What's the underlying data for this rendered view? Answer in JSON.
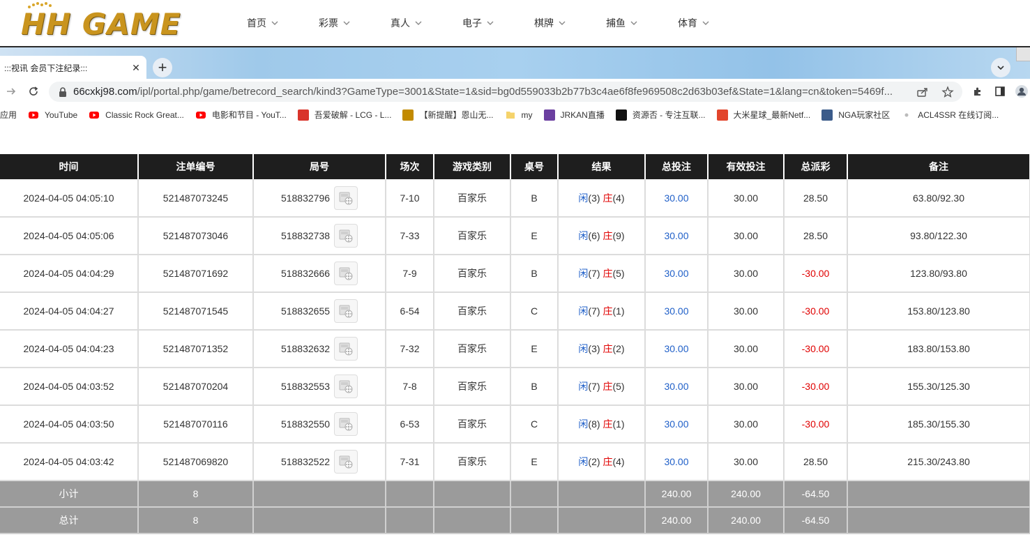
{
  "site": {
    "logo_text": "HH GAME",
    "nav": [
      "首页",
      "彩票",
      "真人",
      "电子",
      "棋牌",
      "捕鱼",
      "体育"
    ]
  },
  "browser": {
    "tab_title": ":::视讯 会员下注纪录:::",
    "url_host": "66cxkj98.com",
    "url_path": "/ipl/portal.php/game/betrecord_search/kind3?GameType=3001&State=1&sid=bg0d559033b2b77b3c4ae6f8fe969508c2d63b03ef&State=1&lang=cn&token=5469f...",
    "bookmarks": [
      {
        "label": "应用",
        "icon": "apps-icon",
        "color": ""
      },
      {
        "label": "YouTube",
        "icon": "youtube-icon",
        "color": "#ff0000"
      },
      {
        "label": "Classic Rock Great...",
        "icon": "youtube-icon",
        "color": "#ff0000"
      },
      {
        "label": "电影和节目 - YouT...",
        "icon": "youtube-icon",
        "color": "#ff0000"
      },
      {
        "label": "吾爱破解 - LCG - L...",
        "icon": "lcg-icon",
        "color": "#d9342b"
      },
      {
        "label": "【新提醒】恩山无...",
        "icon": "right-icon",
        "color": "#c28a00"
      },
      {
        "label": "my",
        "icon": "folder-icon",
        "color": "#f5d36b"
      },
      {
        "label": "JRKAN直播",
        "icon": "jrkan-icon",
        "color": "#6b3fa0"
      },
      {
        "label": "资源否 - 专注互联...",
        "icon": "github-icon",
        "color": "#111111"
      },
      {
        "label": "大米星球_最新Netf...",
        "icon": "rice-icon",
        "color": "#e2452c"
      },
      {
        "label": "NGA玩家社区",
        "icon": "nga-icon",
        "color": "#3b5b8a"
      },
      {
        "label": "ACL4SSR 在线订阅...",
        "icon": "acl-icon",
        "color": "#bbbbbb"
      }
    ]
  },
  "table": {
    "headers": [
      "时间",
      "注单编号",
      "局号",
      "场次",
      "游戏类别",
      "桌号",
      "结果",
      "总投注",
      "有效投注",
      "总派彩",
      "备注"
    ],
    "player_label": "闲",
    "banker_label": "庄",
    "rows": [
      {
        "time": "2024-04-05 04:05:10",
        "bet_id": "521487073245",
        "round": "518832796",
        "session": "7-10",
        "game": "百家乐",
        "table": "B",
        "player": "(3)",
        "banker": "(4)",
        "total": "30.00",
        "valid": "30.00",
        "payout": "28.50",
        "note": "63.80/92.30"
      },
      {
        "time": "2024-04-05 04:05:06",
        "bet_id": "521487073046",
        "round": "518832738",
        "session": "7-33",
        "game": "百家乐",
        "table": "E",
        "player": "(6)",
        "banker": "(9)",
        "total": "30.00",
        "valid": "30.00",
        "payout": "28.50",
        "note": "93.80/122.30"
      },
      {
        "time": "2024-04-05 04:04:29",
        "bet_id": "521487071692",
        "round": "518832666",
        "session": "7-9",
        "game": "百家乐",
        "table": "B",
        "player": "(7)",
        "banker": "(5)",
        "total": "30.00",
        "valid": "30.00",
        "payout": "-30.00",
        "note": "123.80/93.80"
      },
      {
        "time": "2024-04-05 04:04:27",
        "bet_id": "521487071545",
        "round": "518832655",
        "session": "6-54",
        "game": "百家乐",
        "table": "C",
        "player": "(7)",
        "banker": "(1)",
        "total": "30.00",
        "valid": "30.00",
        "payout": "-30.00",
        "note": "153.80/123.80"
      },
      {
        "time": "2024-04-05 04:04:23",
        "bet_id": "521487071352",
        "round": "518832632",
        "session": "7-32",
        "game": "百家乐",
        "table": "E",
        "player": "(3)",
        "banker": "(2)",
        "total": "30.00",
        "valid": "30.00",
        "payout": "-30.00",
        "note": "183.80/153.80"
      },
      {
        "time": "2024-04-05 04:03:52",
        "bet_id": "521487070204",
        "round": "518832553",
        "session": "7-8",
        "game": "百家乐",
        "table": "B",
        "player": "(7)",
        "banker": "(5)",
        "total": "30.00",
        "valid": "30.00",
        "payout": "-30.00",
        "note": "155.30/125.30"
      },
      {
        "time": "2024-04-05 04:03:50",
        "bet_id": "521487070116",
        "round": "518832550",
        "session": "6-53",
        "game": "百家乐",
        "table": "C",
        "player": "(8)",
        "banker": "(1)",
        "total": "30.00",
        "valid": "30.00",
        "payout": "-30.00",
        "note": "185.30/155.30"
      },
      {
        "time": "2024-04-05 04:03:42",
        "bet_id": "521487069820",
        "round": "518832522",
        "session": "7-31",
        "game": "百家乐",
        "table": "E",
        "player": "(2)",
        "banker": "(4)",
        "total": "30.00",
        "valid": "30.00",
        "payout": "28.50",
        "note": "215.30/243.80"
      }
    ],
    "summary": [
      {
        "label": "小计",
        "count": "8",
        "total": "240.00",
        "valid": "240.00",
        "payout": "-64.50"
      },
      {
        "label": "总计",
        "count": "8",
        "total": "240.00",
        "valid": "240.00",
        "payout": "-64.50"
      }
    ]
  }
}
